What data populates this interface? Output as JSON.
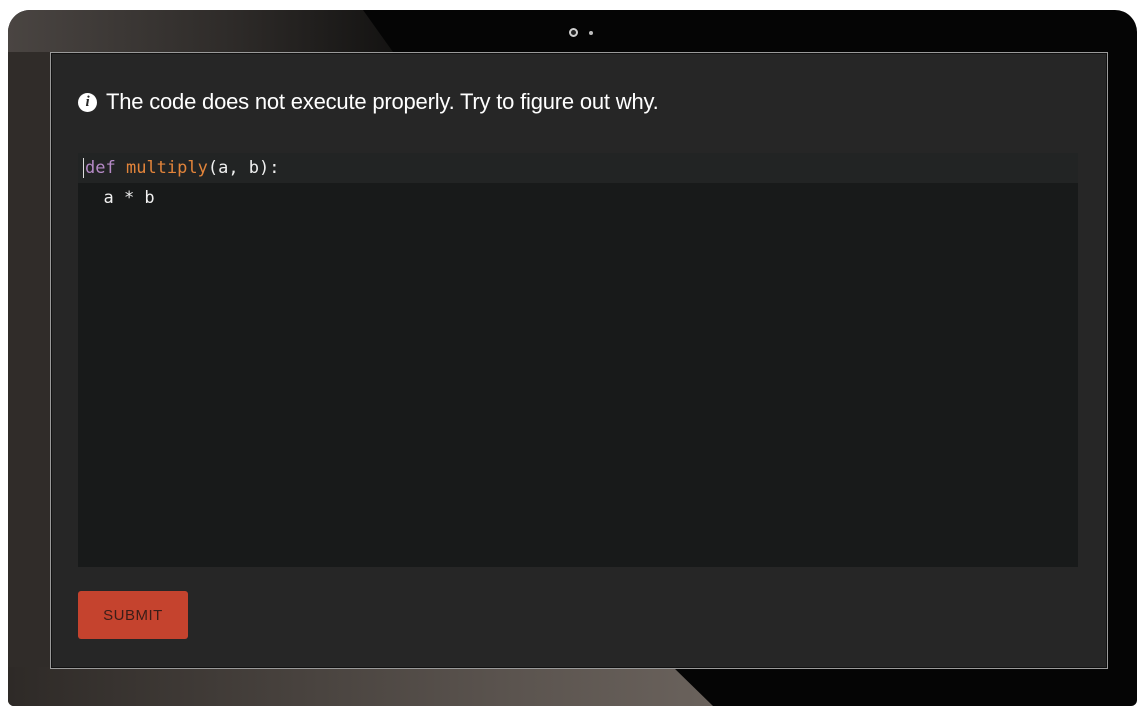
{
  "instruction": {
    "icon": "info-icon",
    "icon_glyph": "i",
    "text": "The code does not execute properly. Try to figure out why."
  },
  "editor": {
    "lines": [
      {
        "tokens": [
          {
            "text": "def",
            "type": "keyword"
          },
          {
            "text": " ",
            "type": "plain"
          },
          {
            "text": "multiply",
            "type": "function"
          },
          {
            "text": "(a, b):",
            "type": "plain"
          }
        ]
      },
      {
        "tokens": [
          {
            "text": "  a * b",
            "type": "plain"
          }
        ]
      }
    ],
    "colors": {
      "keyword": "#b58ac6",
      "function": "#e2843a",
      "plain": "#f0f0f0",
      "background": "#181a1a"
    }
  },
  "actions": {
    "submit_label": "SUBMIT",
    "submit_color": "#c5432e"
  }
}
